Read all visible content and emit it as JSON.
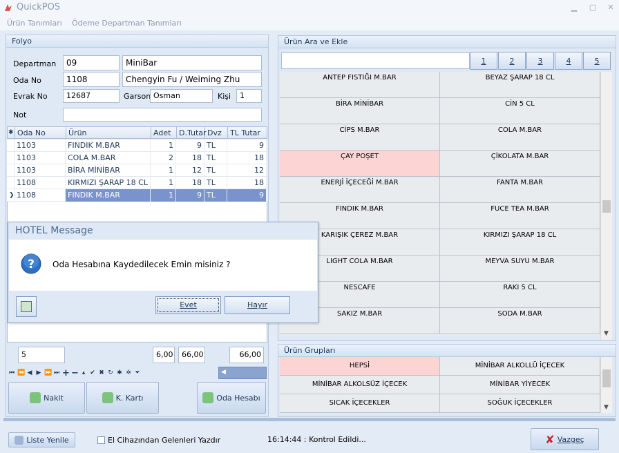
{
  "window": {
    "title": "QuickPOS"
  },
  "menu": [
    "Ürün Tanımları",
    "Ödeme Departman Tanımları"
  ],
  "folyo": {
    "title": "Folyo",
    "departman_label": "Departman",
    "departman_code": "09",
    "departman_name": "MiniBar",
    "oda_label": "Oda No",
    "oda_no": "1108",
    "guest": "Chengyin Fu / Weiming Zhu",
    "evrak_label": "Evrak No",
    "evrak_no": "12687",
    "garson_label": "Garson",
    "garson": "Osman",
    "kisi_label": "Kişi",
    "kisi": "1",
    "not_label": "Not",
    "not": ""
  },
  "grid": {
    "columns": [
      "Oda No",
      "Ürün",
      "Adet",
      "D.Tutar",
      "Dvz",
      "TL Tutar"
    ],
    "rows": [
      {
        "oda": "1103",
        "urun": "FINDIK M.BAR",
        "adet": "1",
        "dtutar": "9",
        "dvz": "TL",
        "tltutar": "9"
      },
      {
        "oda": "1103",
        "urun": "COLA M.BAR",
        "adet": "2",
        "dtutar": "18",
        "dvz": "TL",
        "tltutar": "18"
      },
      {
        "oda": "1103",
        "urun": "BİRA MİNİBAR",
        "adet": "1",
        "dtutar": "12",
        "dvz": "TL",
        "tltutar": "12"
      },
      {
        "oda": "1108",
        "urun": "KIRMIZI ŞARAP 18 CL",
        "adet": "1",
        "dtutar": "18",
        "dvz": "TL",
        "tltutar": "18"
      },
      {
        "oda": "1108",
        "urun": "FINDIK M.BAR",
        "adet": "1",
        "dtutar": "9",
        "dvz": "TL",
        "tltutar": "9"
      }
    ],
    "selected_row": 4
  },
  "footer": {
    "count": "5",
    "adet_total": "6,00",
    "dtutar_total": "66,00",
    "tl_total": "66,00"
  },
  "payment_buttons": {
    "nakit": "Nakit",
    "kkarti": "K. Kartı",
    "oda": "Oda Hesabı"
  },
  "search": {
    "title": "Ürün Ara ve Ekle",
    "value": "",
    "pages": [
      "1",
      "2",
      "3",
      "4",
      "5"
    ]
  },
  "products": [
    "ANTEP FISTIĞI M.BAR",
    "BEYAZ ŞARAP 18 CL",
    "BİRA MİNİBAR",
    "CİN 5 CL",
    "CİPS M.BAR",
    "COLA M.BAR",
    "ÇAY  POŞET",
    "ÇİKOLATA M.BAR",
    "ENERJİ İÇECEĞİ M.BAR",
    "FANTA M.BAR",
    "FINDIK M.BAR",
    "FUCE TEA M.BAR",
    "KARIŞIK ÇEREZ  M.BAR",
    "KIRMIZI ŞARAP 18 CL",
    "LIGHT COLA M.BAR",
    "MEYVA SUYU M.BAR",
    "NESCAFE",
    "RAKI 5 CL",
    "SAKIZ M.BAR",
    "SODA M.BAR"
  ],
  "groups": {
    "title": "Ürün Grupları",
    "items": [
      "HEPSİ",
      "MİNİBAR ALKOLLÜ İÇECEK",
      "MİNİBAR ALKOLSÜZ İÇECEK",
      "MİNİBAR YİYECEK",
      "SICAK İÇECEKLER",
      "SOĞUK İÇECEKLER"
    ]
  },
  "dialog": {
    "title": "HOTEL Message",
    "message": "Oda Hesabına Kaydedilecek Emin misiniz ?",
    "yes": "Evet",
    "no": "Hayır"
  },
  "bottom": {
    "refresh": "Liste Yenile",
    "print_check_label": "El Cihazından Gelenleri Yazdır",
    "status": "16:14:44 : Kontrol Edildi...",
    "cancel": "Vazgeç"
  },
  "colors": {
    "accent": "#7a93cc",
    "pink": "#fcd4d4",
    "panel": "#dfe9f5"
  }
}
